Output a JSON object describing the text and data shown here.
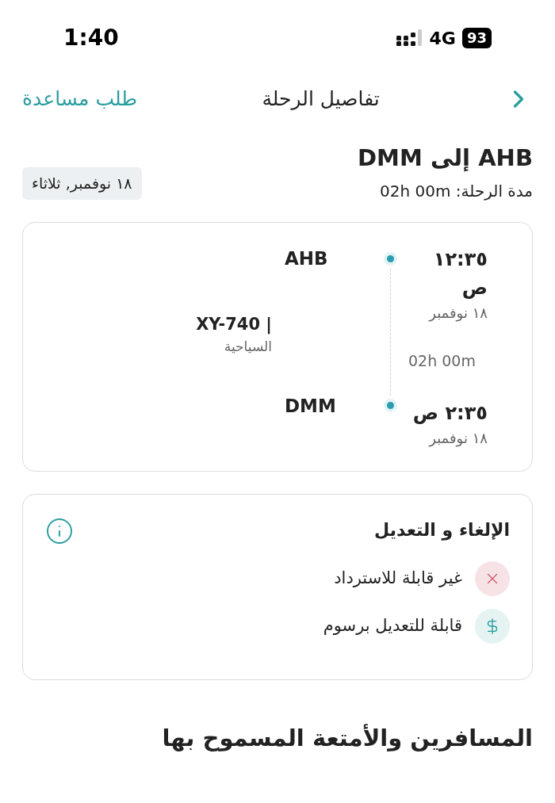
{
  "status_bar": {
    "time": "1:40",
    "network": "4G",
    "battery": "93"
  },
  "header": {
    "title": "تفاصيل الرحلة",
    "help_link": "طلب مساعدة"
  },
  "trip": {
    "route": "AHB إلى DMM",
    "duration": "مدة الرحلة: 02h 00m",
    "date_badge": "١٨ نوفمبر, ثلاثاء"
  },
  "segment": {
    "departure": {
      "time": "١٢:٣٥ ص",
      "date": "١٨ نوفمبر",
      "airport": "AHB"
    },
    "duration": "02h 00m",
    "flight_number": "XY-740 |",
    "cabin": "السياحية",
    "arrival": {
      "time": "٢:٣٥ ص",
      "date": "١٨ نوفمبر",
      "airport": "DMM"
    }
  },
  "policy": {
    "title": "الإلغاء و التعديل",
    "items": [
      {
        "kind": "not_allowed",
        "label": "غير قابلة للاسترداد"
      },
      {
        "kind": "fee",
        "label": "قابلة للتعديل برسوم"
      }
    ]
  },
  "passengers_heading": "المسافرين والأمتعة المسموح بها"
}
